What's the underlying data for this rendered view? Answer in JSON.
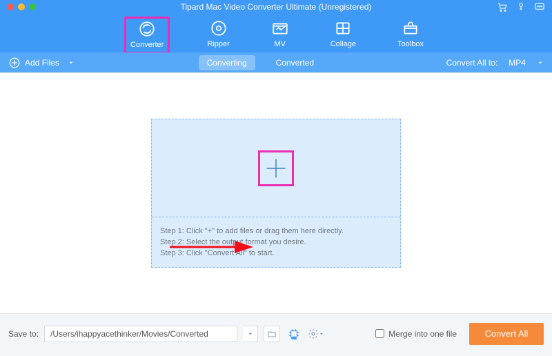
{
  "title": "Tipard Mac Video Converter Ultimate (Unregistered)",
  "nav": {
    "converter": "Converter",
    "ripper": "Ripper",
    "mv": "MV",
    "collage": "Collage",
    "toolbox": "Toolbox"
  },
  "subbar": {
    "add_files": "Add Files",
    "tab_converting": "Converting",
    "tab_converted": "Converted",
    "convert_to_label": "Convert All to:",
    "format": "MP4"
  },
  "steps": {
    "s1": "Step 1: Click \"+\" to add files or drag them here directly.",
    "s2": "Step 2: Select the output format you desire.",
    "s3": "Step 3: Click \"Convert All\" to start."
  },
  "bottom": {
    "save_to": "Save to:",
    "path": "/Users/ihappyacethinker/Movies/Converted",
    "merge": "Merge into one file",
    "convert_all": "Convert All"
  }
}
